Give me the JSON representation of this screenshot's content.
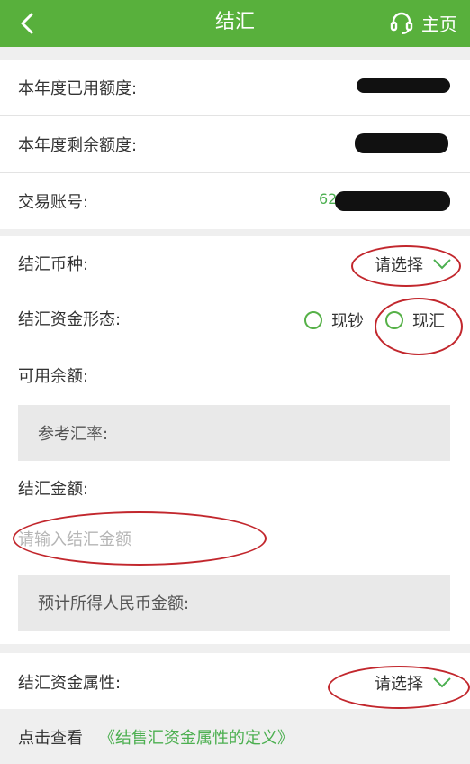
{
  "header": {
    "title": "结汇",
    "home_label": "主页"
  },
  "quota": {
    "used_label": "本年度已用额度:",
    "remaining_label": "本年度剩余额度:",
    "account_label": "交易账号:",
    "account_prefix": "62"
  },
  "form": {
    "currency_label": "结汇币种:",
    "currency_value": "请选择",
    "fund_form_label": "结汇资金形态:",
    "fund_form_options": [
      "现钞",
      "现汇"
    ],
    "available_label": "可用余额:",
    "rate_label": "参考汇率:",
    "amount_label": "结汇金额:",
    "amount_placeholder": "请输入结汇金额",
    "rmb_estimate_label": "预计所得人民币金额:",
    "attribute_label": "结汇资金属性:",
    "attribute_value": "请选择"
  },
  "footer": {
    "prefix": "点击查看",
    "link_text": "《结售汇资金属性的定义》"
  },
  "colors": {
    "header_bg": "#58b03c",
    "accent_green": "#4caf50",
    "annotation_red": "#c2272d"
  }
}
